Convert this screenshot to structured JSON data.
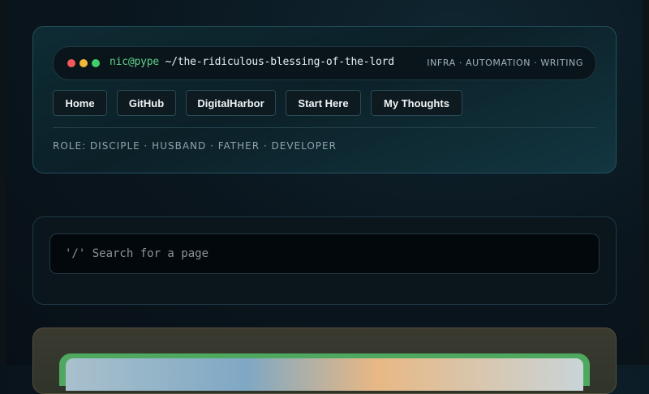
{
  "terminal": {
    "user_host": "nic@pype",
    "path": " ~/the-ridiculous-blessing-of-the-lord",
    "tags": "INFRA · AUTOMATION · WRITING"
  },
  "nav": {
    "items": [
      {
        "label": "Home"
      },
      {
        "label": "GitHub"
      },
      {
        "label": "DigitalHarbor"
      },
      {
        "label": "Start Here"
      },
      {
        "label": "My Thoughts"
      }
    ]
  },
  "role": "ROLE: DISCIPLE · HUSBAND · FATHER · DEVELOPER",
  "search": {
    "placeholder": "'/' Search for a page",
    "value": ""
  },
  "colors": {
    "accent_green": "#5fd08a",
    "dot_red": "#f25a5a",
    "dot_yellow": "#f2b83a",
    "dot_green": "#3fd06b"
  }
}
